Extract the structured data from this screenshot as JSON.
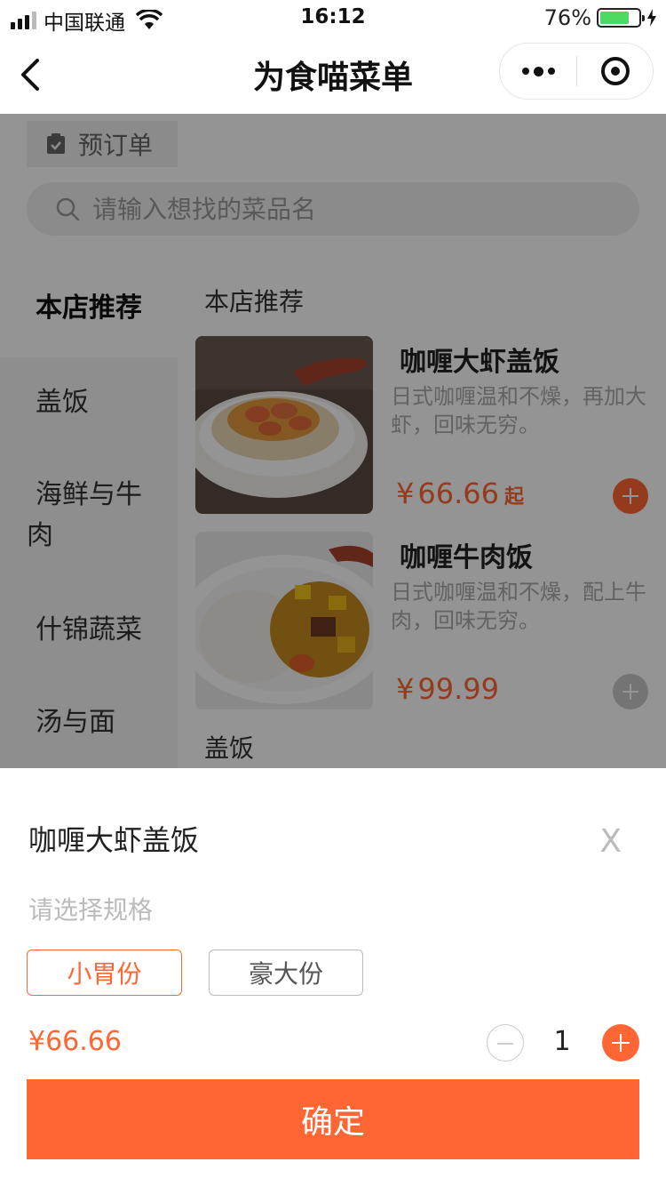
{
  "status_bar": {
    "carrier": "中国联通",
    "time": "16:12",
    "battery": "76%",
    "battery_level": 0.76,
    "icons": [
      "signal-icon",
      "wifi-icon",
      "battery-icon",
      "charging-icon"
    ]
  },
  "nav": {
    "title": "为食喵菜单",
    "icons": [
      "back-icon",
      "more-icon",
      "close-miniprogram-icon"
    ]
  },
  "toolbar": {
    "preorder_label": "预订单"
  },
  "search": {
    "placeholder": "请输入想找的菜品名"
  },
  "sidebar": {
    "items": [
      {
        "label": "本店推荐",
        "active": true
      },
      {
        "label": "盖饭"
      },
      {
        "label": "海鲜与牛肉"
      },
      {
        "label": "什锦蔬菜"
      },
      {
        "label": "汤与面"
      }
    ]
  },
  "menu": {
    "section_recommended": "本店推荐",
    "section_rice": "盖饭",
    "dishes": [
      {
        "name": "咖喱大虾盖饭",
        "desc": "日式咖喱温和不燥，再加大虾，回味无穷。",
        "currency": "¥",
        "price": "66.66",
        "suffix": "起"
      },
      {
        "name": "咖喱牛肉饭",
        "desc": "日式咖喱温和不燥，配上牛肉，回味无穷。",
        "currency": "¥",
        "price": "99.99"
      }
    ]
  },
  "sheet": {
    "title": "咖喱大虾盖饭",
    "close": "X",
    "spec_label": "请选择规格",
    "options": [
      {
        "label": "小胃份",
        "selected": true
      },
      {
        "label": "豪大份",
        "selected": false
      }
    ],
    "price": "¥66.66",
    "quantity": "1",
    "confirm_label": "确定"
  },
  "colors": {
    "accent": "#ff6633",
    "overlay": "rgba(0,0,0,0.42)"
  }
}
